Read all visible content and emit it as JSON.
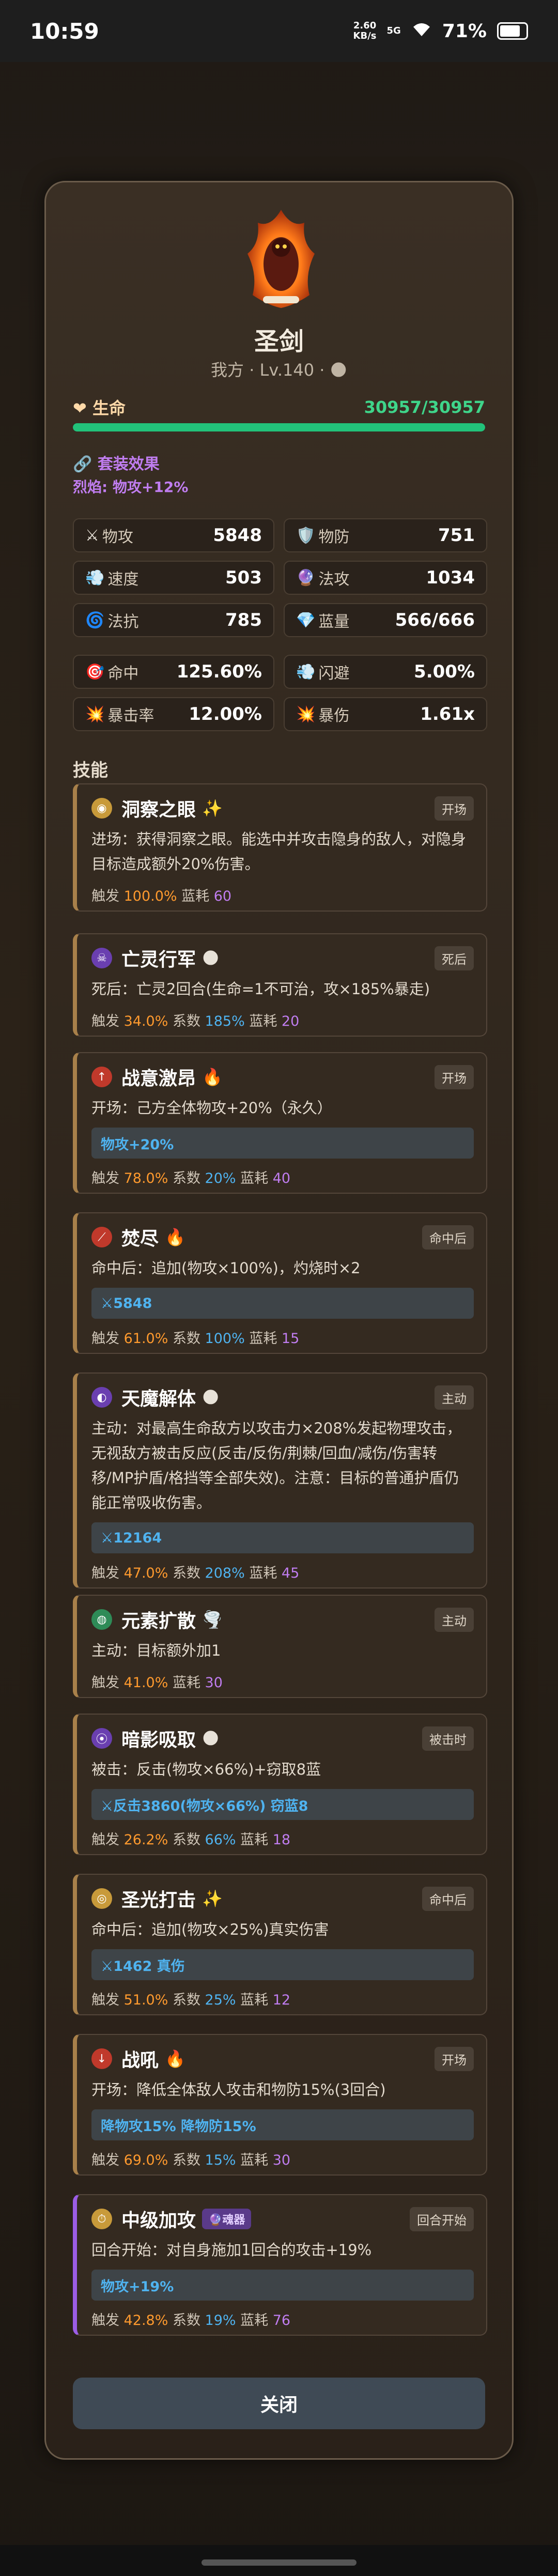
{
  "status": {
    "time": "10:59",
    "net_speed": "2.60\nKB/s",
    "signal": "5G",
    "battery": "71%"
  },
  "char": {
    "name": "圣剑",
    "subtitle": "我方 · Lv.140 · 🌑",
    "hp_label": "❤ 生命",
    "hp_value": "30957/30957",
    "hp_fraction": 1.0
  },
  "set": {
    "title": "🔗 套装效果",
    "line": "烈焰: 物攻+12%"
  },
  "stats": [
    {
      "icon": "⚔",
      "label": "物攻",
      "value": "5848"
    },
    {
      "icon": "🛡️",
      "label": "物防",
      "value": "751"
    },
    {
      "icon": "💨",
      "label": "速度",
      "value": "503"
    },
    {
      "icon": "🔮",
      "label": "法攻",
      "value": "1034"
    },
    {
      "icon": "🌀",
      "label": "法抗",
      "value": "785"
    },
    {
      "icon": "💎",
      "label": "蓝量",
      "value": "566/666"
    },
    {
      "icon": "🎯",
      "label": "命中",
      "value": "125.60%"
    },
    {
      "icon": "💨",
      "label": "闪避",
      "value": "5.00%"
    },
    {
      "icon": "💥",
      "label": "暴击率",
      "value": "12.00%"
    },
    {
      "icon": "💥",
      "label": "暴伤",
      "value": "1.61x"
    }
  ],
  "skills_title": "技能",
  "skills": [
    {
      "name": "洞察之眼",
      "emoji": "✨",
      "tag": "开场",
      "desc": "进场：获得洞察之眼。能选中并攻击隐身的敌人，对隐身目标造成额外20%伤害。",
      "box": "",
      "trigger": "100.0%",
      "coef": "",
      "cost": "60"
    },
    {
      "name": "亡灵行军",
      "emoji": "🌑",
      "tag": "死后",
      "desc": "死后：亡灵2回合(生命=1不可治，攻×185%暴走)",
      "box": "",
      "trigger": "34.0%",
      "coef": "185%",
      "cost": "20"
    },
    {
      "name": "战意激昂",
      "emoji": "🔥",
      "tag": "开场",
      "desc": "开场：己方全体物攻+20%（永久）",
      "box": "物攻+20%",
      "trigger": "78.0%",
      "coef": "20%",
      "cost": "40"
    },
    {
      "name": "焚尽",
      "emoji": "🔥",
      "tag": "命中后",
      "desc": "命中后：追加(物攻×100%)，灼烧时×2",
      "box": "⚔5848",
      "trigger": "61.0%",
      "coef": "100%",
      "cost": "15"
    },
    {
      "name": "天魔解体",
      "emoji": "🌑",
      "tag": "主动",
      "desc": "主动：对最高生命敌方以攻击力×208%发起物理攻击，无视敌方被击反应(反击/反伤/荆棘/回血/减伤/伤害转移/MP护盾/格挡等全部失效)。注意：目标的普通护盾仍能正常吸收伤害。",
      "box": "⚔12164",
      "trigger": "47.0%",
      "coef": "208%",
      "cost": "45"
    },
    {
      "name": "元素扩散",
      "emoji": "🌪️",
      "tag": "主动",
      "desc": "主动：目标额外加1",
      "box": "",
      "trigger": "41.0%",
      "coef": "",
      "cost": "30"
    },
    {
      "name": "暗影吸取",
      "emoji": "🌑",
      "tag": "被击时",
      "desc": "被击：反击(物攻×66%)+窃取8蓝",
      "box": "⚔反击3860(物攻×66%) 窃蓝8",
      "trigger": "26.2%",
      "coef": "66%",
      "cost": "18"
    },
    {
      "name": "圣光打击",
      "emoji": "✨",
      "tag": "命中后",
      "desc": "命中后：追加(物攻×25%)真实伤害",
      "box": "⚔1462 真伤",
      "trigger": "51.0%",
      "coef": "25%",
      "cost": "12"
    },
    {
      "name": "战吼",
      "emoji": "🔥",
      "tag": "开场",
      "desc": "开场：降低全体敌人攻击和物防15%(3回合)",
      "box": "降物攻15%  降物防15%",
      "trigger": "69.0%",
      "coef": "15%",
      "cost": "30"
    },
    {
      "name": "中级加攻",
      "emoji": "",
      "badge": "🔮魂器",
      "tag": "回合开始",
      "desc": "回合开始：对自身施加1回合的攻击+19%",
      "box": "物攻+19%",
      "trigger": "42.8%",
      "coef": "19%",
      "cost": "76"
    }
  ],
  "labels": {
    "trigger": "触发",
    "coef": "系数",
    "cost": "蓝耗"
  },
  "close_label": "关闭",
  "colors": {
    "hp": "#22c27a",
    "accent_orange": "#ff9a2e",
    "accent_blue": "#4fb3f0",
    "accent_purple": "#c07df0"
  }
}
